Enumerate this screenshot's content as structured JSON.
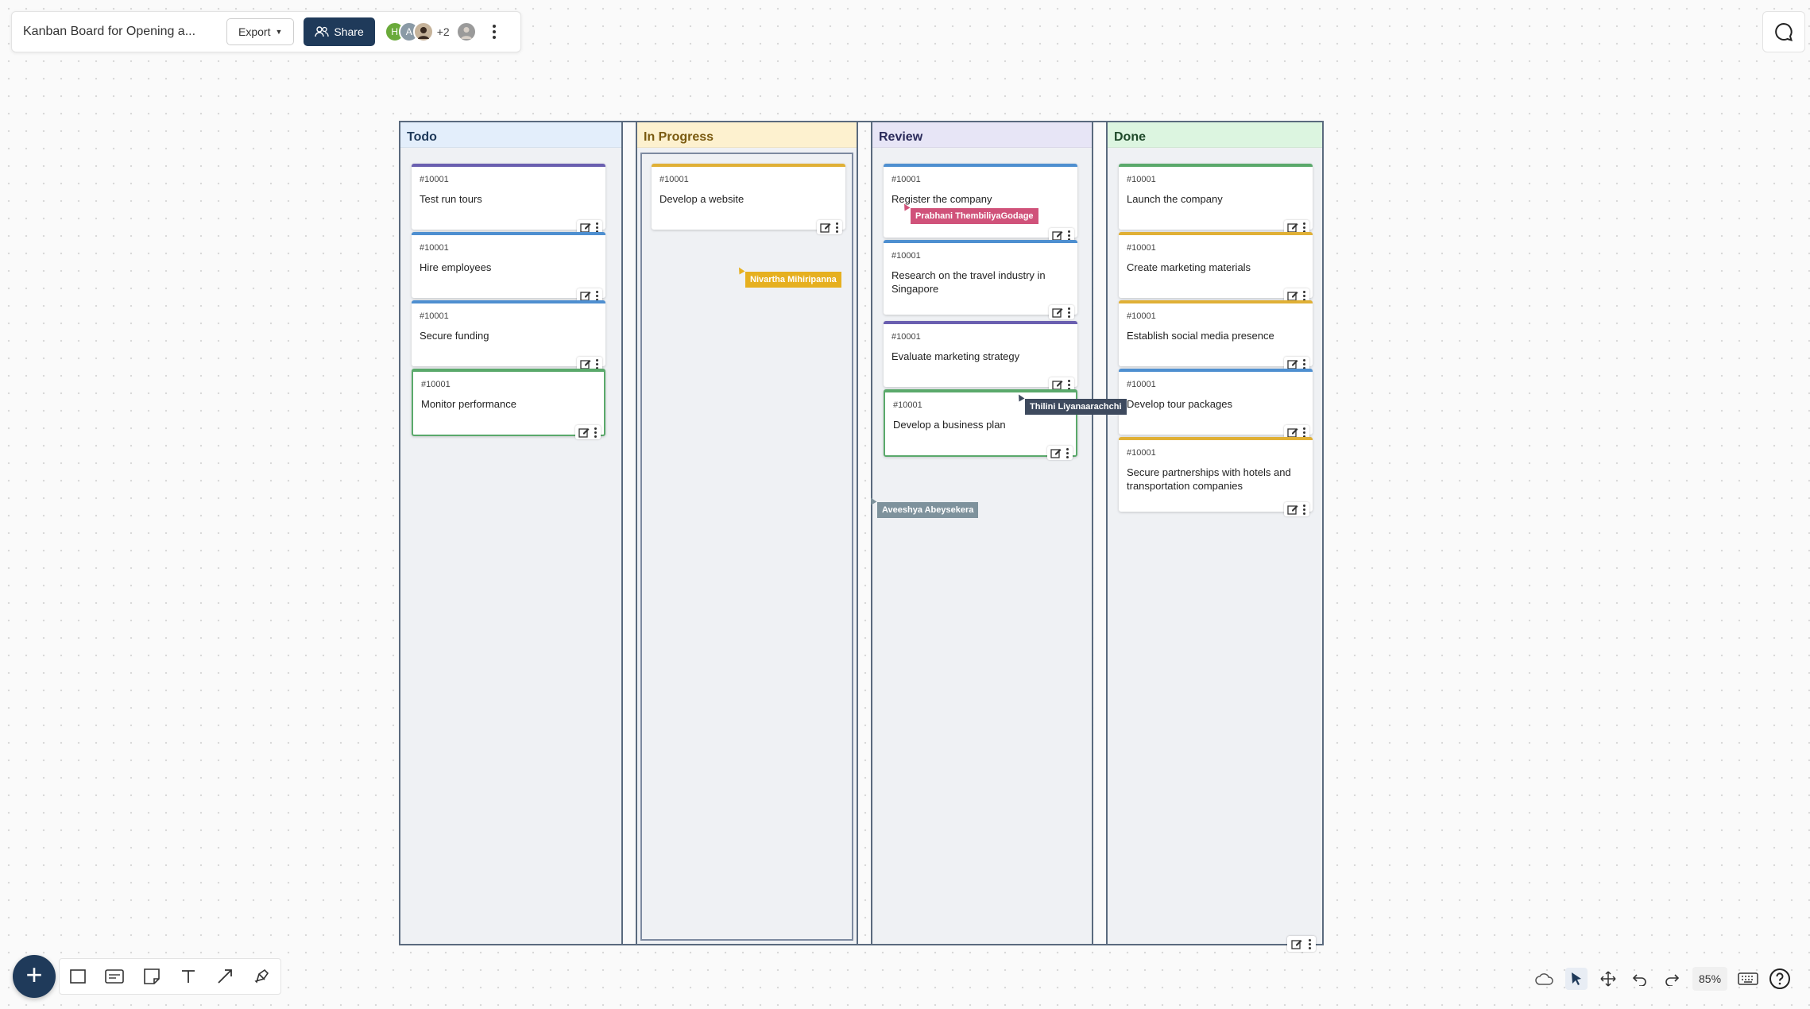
{
  "toolbar": {
    "board_title": "Kanban Board for Opening a...",
    "export_label": "Export",
    "share_label": "Share",
    "avatars": [
      {
        "initial": "H",
        "color": "#6aaa3a"
      },
      {
        "initial": "A",
        "color": "#8a9aa6"
      },
      {
        "initial": "",
        "color": "#c6b39a"
      }
    ],
    "avatar_more": "+2"
  },
  "columns": [
    {
      "title": "Todo",
      "header_color": "#e3eefb",
      "header_text": "#1f3a5a",
      "cards": [
        {
          "id": "#10001",
          "title": "Test run tours",
          "color": "#6a5fb0"
        },
        {
          "id": "#10001",
          "title": "Hire employees",
          "color": "#4e8fd0"
        },
        {
          "id": "#10001",
          "title": "Secure funding",
          "color": "#4e8fd0"
        },
        {
          "id": "#10001",
          "title": "Monitor performance",
          "color": "#5aa96b"
        }
      ]
    },
    {
      "title": "In Progress",
      "header_color": "#fdf1cf",
      "header_text": "#7a5a10",
      "cards": [
        {
          "id": "#10001",
          "title": "Develop a website",
          "color": "#e0b036"
        }
      ]
    },
    {
      "title": "Review",
      "header_color": "#e7e5f6",
      "header_text": "#2a2a5a",
      "cards": [
        {
          "id": "#10001",
          "title": "Register the company",
          "color": "#4e8fd0"
        },
        {
          "id": "#10001",
          "title": "Research on the travel industry in Singapore",
          "color": "#4e8fd0"
        },
        {
          "id": "#10001",
          "title": "Evaluate marketing strategy",
          "color": "#6a5fb0"
        },
        {
          "id": "#10001",
          "title": "Develop a business plan",
          "color": "#5aa96b"
        }
      ]
    },
    {
      "title": "Done",
      "header_color": "#dcf5e0",
      "header_text": "#1f4a2a",
      "cards": [
        {
          "id": "#10001",
          "title": "Launch the company",
          "color": "#5aa96b"
        },
        {
          "id": "#10001",
          "title": "Create marketing materials",
          "color": "#e0b036"
        },
        {
          "id": "#10001",
          "title": "Establish social media presence",
          "color": "#e0b036"
        },
        {
          "id": "#10001",
          "title": "Develop tour packages",
          "color": "#4e8fd0"
        },
        {
          "id": "#10001",
          "title": "Secure partnerships with hotels and transportation companies",
          "color": "#e0b036"
        }
      ]
    }
  ],
  "cursors": [
    {
      "name": "Prabhani ThembiliyaGodage",
      "color": "#d0527a"
    },
    {
      "name": "Nivartha Mihiripanna",
      "color": "#e6b020"
    },
    {
      "name": "Thilini Liyanaarachchi",
      "color": "#3e4a5e"
    },
    {
      "name": "Aveeshya Abeysekera",
      "color": "#7e929c"
    }
  ],
  "controls": {
    "zoom": "85%"
  }
}
